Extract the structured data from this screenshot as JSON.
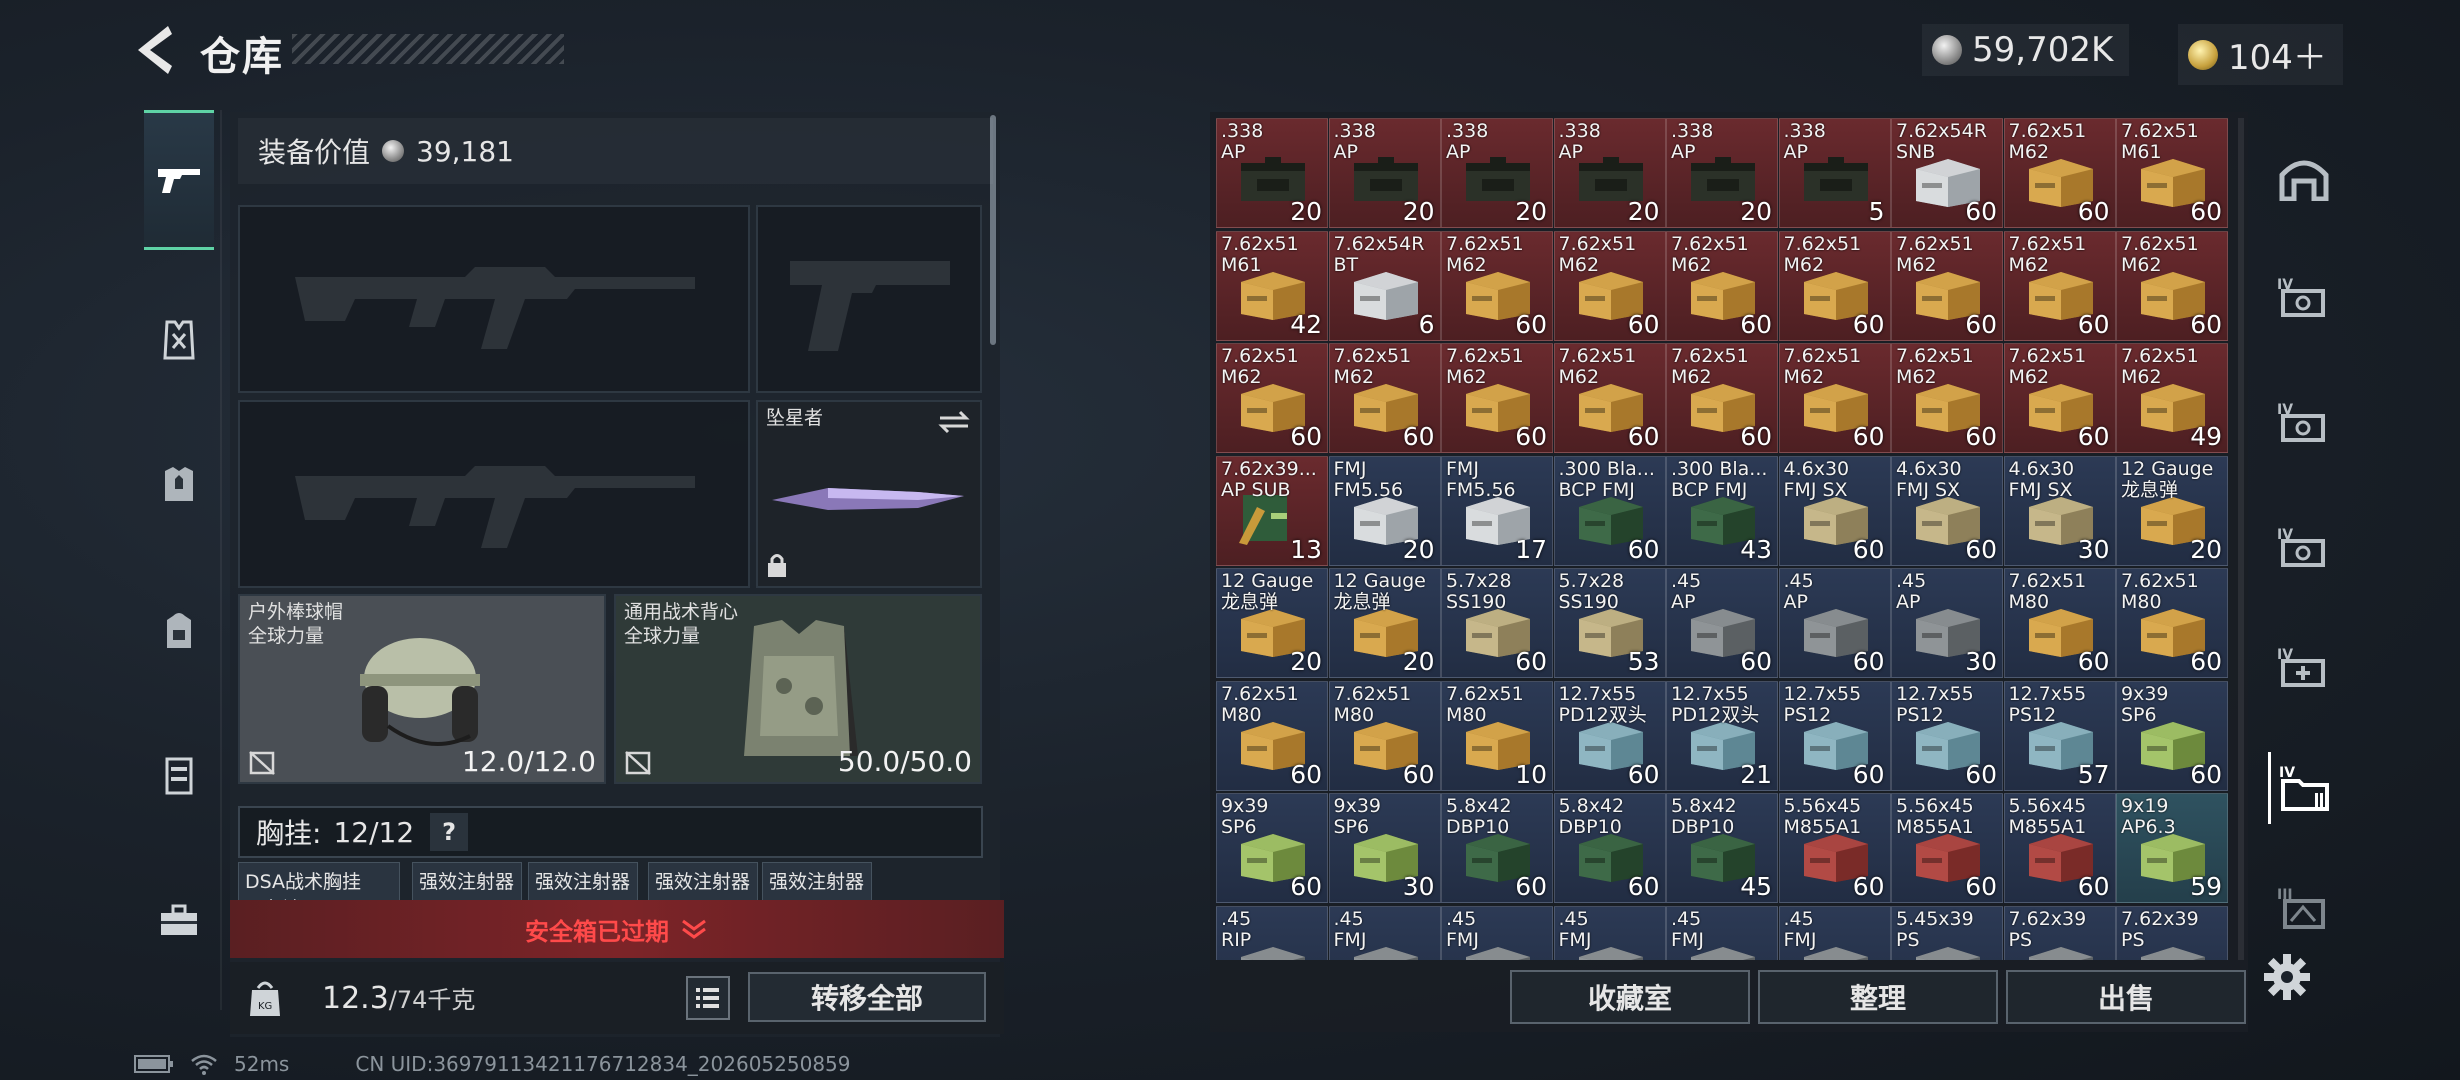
{
  "header": {
    "title": "仓库",
    "currency_main": "59,702K",
    "currency_premium": "104＋"
  },
  "equipment": {
    "value_label": "装备价值",
    "value": "39,181"
  },
  "slots": {
    "melee_label": "坠星者",
    "helmet_label": "户外棒球帽\n全球力量",
    "helmet_value": "12.0/12.0",
    "armor_label": "通用战术背心\n全球力量",
    "armor_value": "50.0/50.0"
  },
  "rig": {
    "label": "胸挂:",
    "capacity": "12/12",
    "help": "?",
    "items": [
      {
        "label": "DSA战术胸挂\n三色迷"
      },
      {
        "label": "强效注射器"
      },
      {
        "label": "强效注射器"
      },
      {
        "label": "强效注射器"
      },
      {
        "label": "强效注射器"
      }
    ]
  },
  "safebox": {
    "expired_text": "安全箱已过期"
  },
  "footer": {
    "weight_current": "12.3",
    "weight_max": "/74千克",
    "transfer_all": "转移全部"
  },
  "status_bar": {
    "ping": "52ms",
    "uid": "CN UID:36979113421176712834_202605250859"
  },
  "grid_buttons": {
    "collection": "收藏室",
    "sort": "整理",
    "sell": "出售"
  },
  "inventory": [
    {
      "name": ".338\nAP",
      "count": "20",
      "bg": "r",
      "box": "ammocan"
    },
    {
      "name": ".338\nAP",
      "count": "20",
      "bg": "r",
      "box": "ammocan"
    },
    {
      "name": ".338\nAP",
      "count": "20",
      "bg": "r",
      "box": "ammocan"
    },
    {
      "name": ".338\nAP",
      "count": "20",
      "bg": "r",
      "box": "ammocan"
    },
    {
      "name": ".338\nAP",
      "count": "20",
      "bg": "r",
      "box": "ammocan"
    },
    {
      "name": ".338\nAP",
      "count": "5",
      "bg": "r",
      "box": "ammocan"
    },
    {
      "name": "7.62x54R\nSNB",
      "count": "60",
      "bg": "r",
      "box": "white"
    },
    {
      "name": "7.62x51\nM62",
      "count": "60",
      "bg": "r",
      "box": "yellow"
    },
    {
      "name": "7.62x51\nM61",
      "count": "60",
      "bg": "r",
      "box": "yellow"
    },
    {
      "name": "7.62x51\nM61",
      "count": "42",
      "bg": "r",
      "box": "yellow"
    },
    {
      "name": "7.62x54R\nBT",
      "count": "6",
      "bg": "r",
      "box": "white"
    },
    {
      "name": "7.62x51\nM62",
      "count": "60",
      "bg": "r",
      "box": "yellow"
    },
    {
      "name": "7.62x51\nM62",
      "count": "60",
      "bg": "r",
      "box": "yellow"
    },
    {
      "name": "7.62x51\nM62",
      "count": "60",
      "bg": "r",
      "box": "yellow"
    },
    {
      "name": "7.62x51\nM62",
      "count": "60",
      "bg": "r",
      "box": "yellow"
    },
    {
      "name": "7.62x51\nM62",
      "count": "60",
      "bg": "r",
      "box": "yellow"
    },
    {
      "name": "7.62x51\nM62",
      "count": "60",
      "bg": "r",
      "box": "yellow"
    },
    {
      "name": "7.62x51\nM62",
      "count": "60",
      "bg": "r",
      "box": "yellow"
    },
    {
      "name": "7.62x51\nM62",
      "count": "60",
      "bg": "r",
      "box": "yellow"
    },
    {
      "name": "7.62x51\nM62",
      "count": "60",
      "bg": "r",
      "box": "yellow"
    },
    {
      "name": "7.62x51\nM62",
      "count": "60",
      "bg": "r",
      "box": "yellow"
    },
    {
      "name": "7.62x51\nM62",
      "count": "60",
      "bg": "r",
      "box": "yellow"
    },
    {
      "name": "7.62x51\nM62",
      "count": "60",
      "bg": "r",
      "box": "yellow"
    },
    {
      "name": "7.62x51\nM62",
      "count": "60",
      "bg": "r",
      "box": "yellow"
    },
    {
      "name": "7.62x51\nM62",
      "count": "60",
      "bg": "r",
      "box": "yellow"
    },
    {
      "name": "7.62x51\nM62",
      "count": "60",
      "bg": "r",
      "box": "yellow"
    },
    {
      "name": "7.62x51\nM62",
      "count": "49",
      "bg": "r",
      "box": "yellow"
    },
    {
      "name": "7.62x39...\nAP SUB",
      "count": "13",
      "bg": "r",
      "box": "bullet"
    },
    {
      "name": "FMJ\nFM5.56",
      "count": "20",
      "bg": "b",
      "box": "white"
    },
    {
      "name": "FMJ\nFM5.56",
      "count": "17",
      "bg": "b",
      "box": "white"
    },
    {
      "name": ".300 Bla...\nBCP FMJ",
      "count": "60",
      "bg": "b",
      "box": "green"
    },
    {
      "name": ".300 Bla...\nBCP FMJ",
      "count": "43",
      "bg": "b",
      "box": "green"
    },
    {
      "name": "4.6x30\nFMJ SX",
      "count": "60",
      "bg": "b",
      "box": "tan"
    },
    {
      "name": "4.6x30\nFMJ SX",
      "count": "60",
      "bg": "b",
      "box": "tan"
    },
    {
      "name": "4.6x30\nFMJ SX",
      "count": "30",
      "bg": "b",
      "box": "tan"
    },
    {
      "name": "12 Gauge\n龙息弹",
      "count": "20",
      "bg": "b",
      "box": "yellow"
    },
    {
      "name": "12 Gauge\n龙息弹",
      "count": "20",
      "bg": "b",
      "box": "yellow"
    },
    {
      "name": "12 Gauge\n龙息弹",
      "count": "20",
      "bg": "b",
      "box": "yellow"
    },
    {
      "name": "5.7x28\nSS190",
      "count": "60",
      "bg": "b",
      "box": "tan"
    },
    {
      "name": "5.7x28\nSS190",
      "count": "53",
      "bg": "b",
      "box": "tan"
    },
    {
      "name": ".45\nAP",
      "count": "60",
      "bg": "b",
      "box": "grey"
    },
    {
      "name": ".45\nAP",
      "count": "60",
      "bg": "b",
      "box": "grey"
    },
    {
      "name": ".45\nAP",
      "count": "30",
      "bg": "b",
      "box": "grey"
    },
    {
      "name": "7.62x51\nM80",
      "count": "60",
      "bg": "b",
      "box": "yellow"
    },
    {
      "name": "7.62x51\nM80",
      "count": "60",
      "bg": "b",
      "box": "yellow"
    },
    {
      "name": "7.62x51\nM80",
      "count": "60",
      "bg": "b",
      "box": "yellow"
    },
    {
      "name": "7.62x51\nM80",
      "count": "60",
      "bg": "b",
      "box": "yellow"
    },
    {
      "name": "7.62x51\nM80",
      "count": "10",
      "bg": "b",
      "box": "yellow"
    },
    {
      "name": "12.7x55\nPD12双头",
      "count": "60",
      "bg": "b",
      "box": "cyan"
    },
    {
      "name": "12.7x55\nPD12双头",
      "count": "21",
      "bg": "b",
      "box": "cyan"
    },
    {
      "name": "12.7x55\nPS12",
      "count": "60",
      "bg": "b",
      "box": "cyan"
    },
    {
      "name": "12.7x55\nPS12",
      "count": "60",
      "bg": "b",
      "box": "cyan"
    },
    {
      "name": "12.7x55\nPS12",
      "count": "57",
      "bg": "b",
      "box": "cyan"
    },
    {
      "name": "9x39\nSP6",
      "count": "60",
      "bg": "b",
      "box": "lime"
    },
    {
      "name": "9x39\nSP6",
      "count": "60",
      "bg": "b",
      "box": "lime"
    },
    {
      "name": "9x39\nSP6",
      "count": "30",
      "bg": "b",
      "box": "lime"
    },
    {
      "name": "5.8x42\nDBP10",
      "count": "60",
      "bg": "b",
      "box": "green"
    },
    {
      "name": "5.8x42\nDBP10",
      "count": "60",
      "bg": "b",
      "box": "green"
    },
    {
      "name": "5.8x42\nDBP10",
      "count": "45",
      "bg": "b",
      "box": "green"
    },
    {
      "name": "5.56x45\nM855A1",
      "count": "60",
      "bg": "b",
      "box": "red"
    },
    {
      "name": "5.56x45\nM855A1",
      "count": "60",
      "bg": "b",
      "box": "red"
    },
    {
      "name": "5.56x45\nM855A1",
      "count": "60",
      "bg": "b",
      "box": "red"
    },
    {
      "name": "9x19\nAP6.3",
      "count": "59",
      "bg": "t",
      "box": "lime"
    },
    {
      "name": ".45\nRIP",
      "count": "",
      "bg": "b",
      "box": "grey"
    },
    {
      "name": ".45\nFMJ",
      "count": "",
      "bg": "b",
      "box": "grey"
    },
    {
      "name": ".45\nFMJ",
      "count": "",
      "bg": "b",
      "box": "grey"
    },
    {
      "name": ".45\nFMJ",
      "count": "",
      "bg": "b",
      "box": "grey"
    },
    {
      "name": ".45\nFMJ",
      "count": "",
      "bg": "b",
      "box": "grey"
    },
    {
      "name": ".45\nFMJ",
      "count": "",
      "bg": "b",
      "box": "grey"
    },
    {
      "name": "5.45x39\nPS",
      "count": "",
      "bg": "b",
      "box": "grey"
    },
    {
      "name": "7.62x39\nPS",
      "count": "",
      "bg": "b",
      "box": "grey"
    },
    {
      "name": "7.62x39\nPS",
      "count": "",
      "bg": "b",
      "box": "grey"
    }
  ],
  "colors": {
    "accent": "#5fd3a6",
    "warning": "#ff4a4a",
    "tier_red": "#6a2a2e",
    "tier_blue": "#2c3a55",
    "tier_teal": "#2f5260"
  }
}
